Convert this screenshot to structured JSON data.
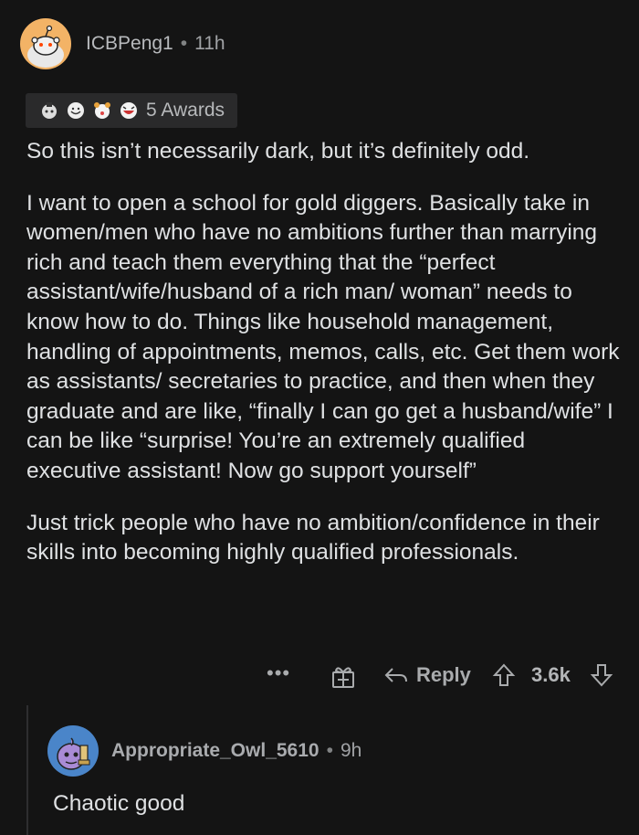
{
  "comment": {
    "author": "ICBPeng1",
    "separator": "•",
    "time": "11h",
    "awards_label": "5 Awards",
    "award_icons": [
      "cake-award-icon",
      "wholesome-award-icon",
      "helpful-award-icon",
      "laughing-award-icon"
    ],
    "paragraphs": [
      "So this isn’t necessarily dark, but it’s definitely odd.",
      "I want to open a school for gold diggers. Basically take in women/men who have no ambitions further than marrying rich and teach them everything that the “perfect assistant/wife/husband of a rich man/ woman” needs to know how to do. Things like household management, handling of appointments, memos, calls, etc. Get them work as assistants/ secretaries to practice, and then when they graduate and are like, “finally I can go get a husband/wife” I can be like “surprise! You’re an extremely qualified executive assistant! Now go support yourself”",
      "Just trick people who have no ambition/confidence in their skills into becoming highly qualified professionals."
    ],
    "actions": {
      "more": "•••",
      "reply_label": "Reply",
      "score": "3.6k"
    }
  },
  "reply": {
    "author": "Appropriate_Owl_5610",
    "separator": "•",
    "time": "9h",
    "text": "Chaotic good"
  },
  "colors": {
    "background": "#141414",
    "text": "#dfe1e3",
    "muted": "#a9abad",
    "avatar_orange": "#f3b366",
    "avatar_blue": "#4a85c9"
  }
}
